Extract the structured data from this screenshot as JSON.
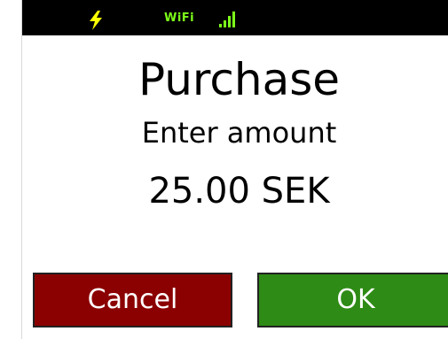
{
  "status_bar": {
    "power_icon": "lightning-bolt-icon",
    "wifi_label": "WiFi",
    "signal_icon": "signal-bars-icon",
    "accent_color": "#7dff1a",
    "bolt_color": "#ffff00",
    "background": "#000000"
  },
  "screen": {
    "title": "Purchase",
    "prompt": "Enter amount",
    "amount": "25.00 SEK"
  },
  "buttons": {
    "cancel_label": "Cancel",
    "cancel_color": "#8b0000",
    "ok_label": "OK",
    "ok_color": "#2e8b15"
  }
}
